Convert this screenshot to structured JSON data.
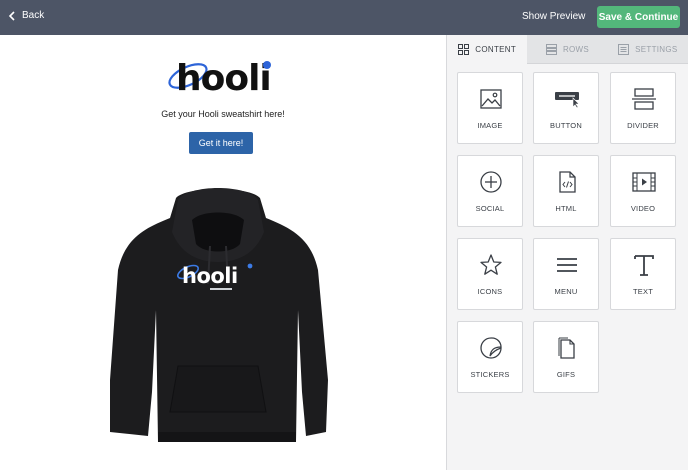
{
  "topbar": {
    "back_label": "Back",
    "preview_label": "Show Preview",
    "save_label": "Save & Continue"
  },
  "email": {
    "logo_text": "hooli",
    "tagline": "Get your Hooli sweatshirt here!",
    "cta_label": "Get it here!"
  },
  "panel": {
    "tabs": [
      {
        "label": "CONTENT",
        "icon": "grid-icon",
        "active": true
      },
      {
        "label": "ROWS",
        "icon": "rows-icon",
        "active": false
      },
      {
        "label": "SETTINGS",
        "icon": "settings-icon",
        "active": false
      }
    ],
    "tiles": [
      {
        "label": "IMAGE",
        "icon": "image-icon"
      },
      {
        "label": "BUTTON",
        "icon": "button-icon"
      },
      {
        "label": "DIVIDER",
        "icon": "divider-icon"
      },
      {
        "label": "SOCIAL",
        "icon": "social-icon"
      },
      {
        "label": "HTML",
        "icon": "html-icon"
      },
      {
        "label": "VIDEO",
        "icon": "video-icon"
      },
      {
        "label": "ICONS",
        "icon": "star-icon"
      },
      {
        "label": "MENU",
        "icon": "menu-icon"
      },
      {
        "label": "TEXT",
        "icon": "text-icon"
      },
      {
        "label": "STICKERS",
        "icon": "sticker-icon"
      },
      {
        "label": "GIFS",
        "icon": "gif-icon"
      }
    ]
  },
  "colors": {
    "topbar": "#4d5566",
    "save": "#53b77b",
    "cta": "#2d64a8",
    "panel": "#f4f4f5"
  }
}
